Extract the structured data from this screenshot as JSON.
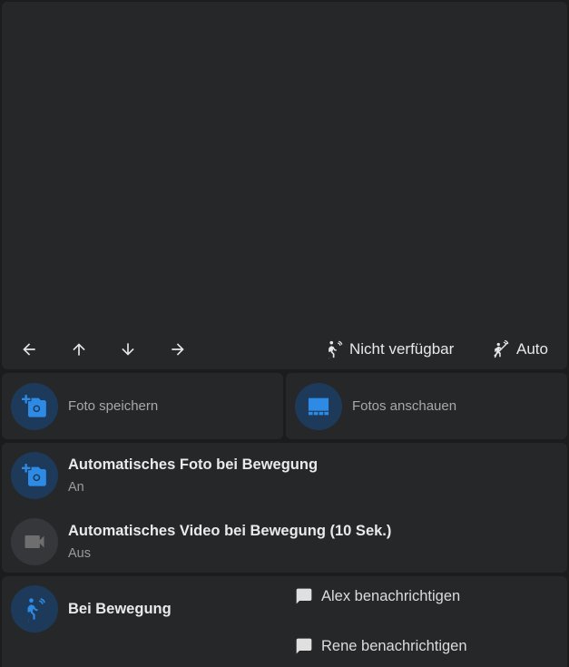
{
  "camera": {
    "nav": [
      "arrow-left-icon",
      "arrow-up-icon",
      "arrow-down-icon",
      "arrow-right-icon"
    ],
    "motion_status_label": "Nicht verfügbar",
    "mode_label": "Auto"
  },
  "actions": {
    "save_photo_label": "Foto speichern",
    "view_photos_label": "Fotos anschauen"
  },
  "automation": {
    "photo_title": "Automatisches Foto bei Bewegung",
    "photo_state": "An",
    "video_title": "Automatisches Video bei Bewegung (10 Sek.)",
    "video_state": "Aus"
  },
  "motion": {
    "title": "Bei Bewegung",
    "notify": [
      "Alex benachrichtigen",
      "Rene benachrichtigen"
    ]
  },
  "colors": {
    "background": "#1c1c1c",
    "card": "#262729",
    "accent": "#2d8be6",
    "badge_blue": "#1e3a5a",
    "badge_grey": "#35373a"
  }
}
